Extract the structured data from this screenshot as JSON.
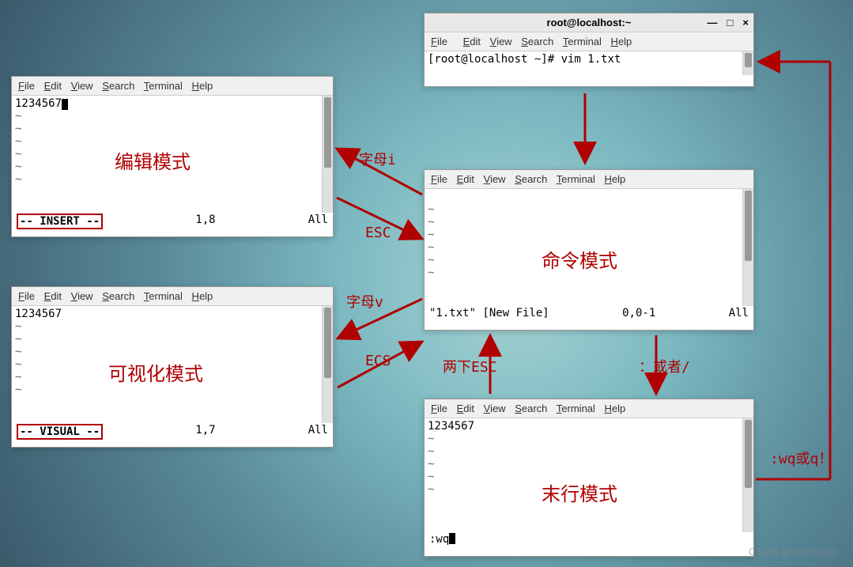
{
  "menu": {
    "file": "File",
    "edit": "Edit",
    "view": "View",
    "search": "Search",
    "terminal": "Terminal",
    "help": "Help"
  },
  "titlebar": {
    "title": "root@localhost:~",
    "min": "—",
    "max": "□",
    "close": "×"
  },
  "winA": {
    "prompt": "[root@localhost ~]# vim 1.txt"
  },
  "winEdit": {
    "text": "1234567",
    "mode": "编辑模式",
    "status_mode": "-- INSERT --",
    "pos": "1,8",
    "pct": "All"
  },
  "winVisual": {
    "text": "1234567",
    "mode": "可视化模式",
    "status_mode": "-- VISUAL --",
    "pos": "1,7",
    "pct": "All"
  },
  "winCmd": {
    "mode": "命令模式",
    "status_file": "\"1.txt\" [New File]",
    "pos": "0,0-1",
    "pct": "All"
  },
  "winLast": {
    "text": "1234567",
    "mode": "末行模式",
    "cmd": ":wq"
  },
  "labels": {
    "key_i": "字母i",
    "esc": "ESC",
    "key_v": "字母v",
    "ecs": "ECS",
    "esc_twice": "两下ESC",
    "colon_slash": "：或者/",
    "wq": ":wq或q！"
  },
  "watermark": "CSDN @smile.ding"
}
